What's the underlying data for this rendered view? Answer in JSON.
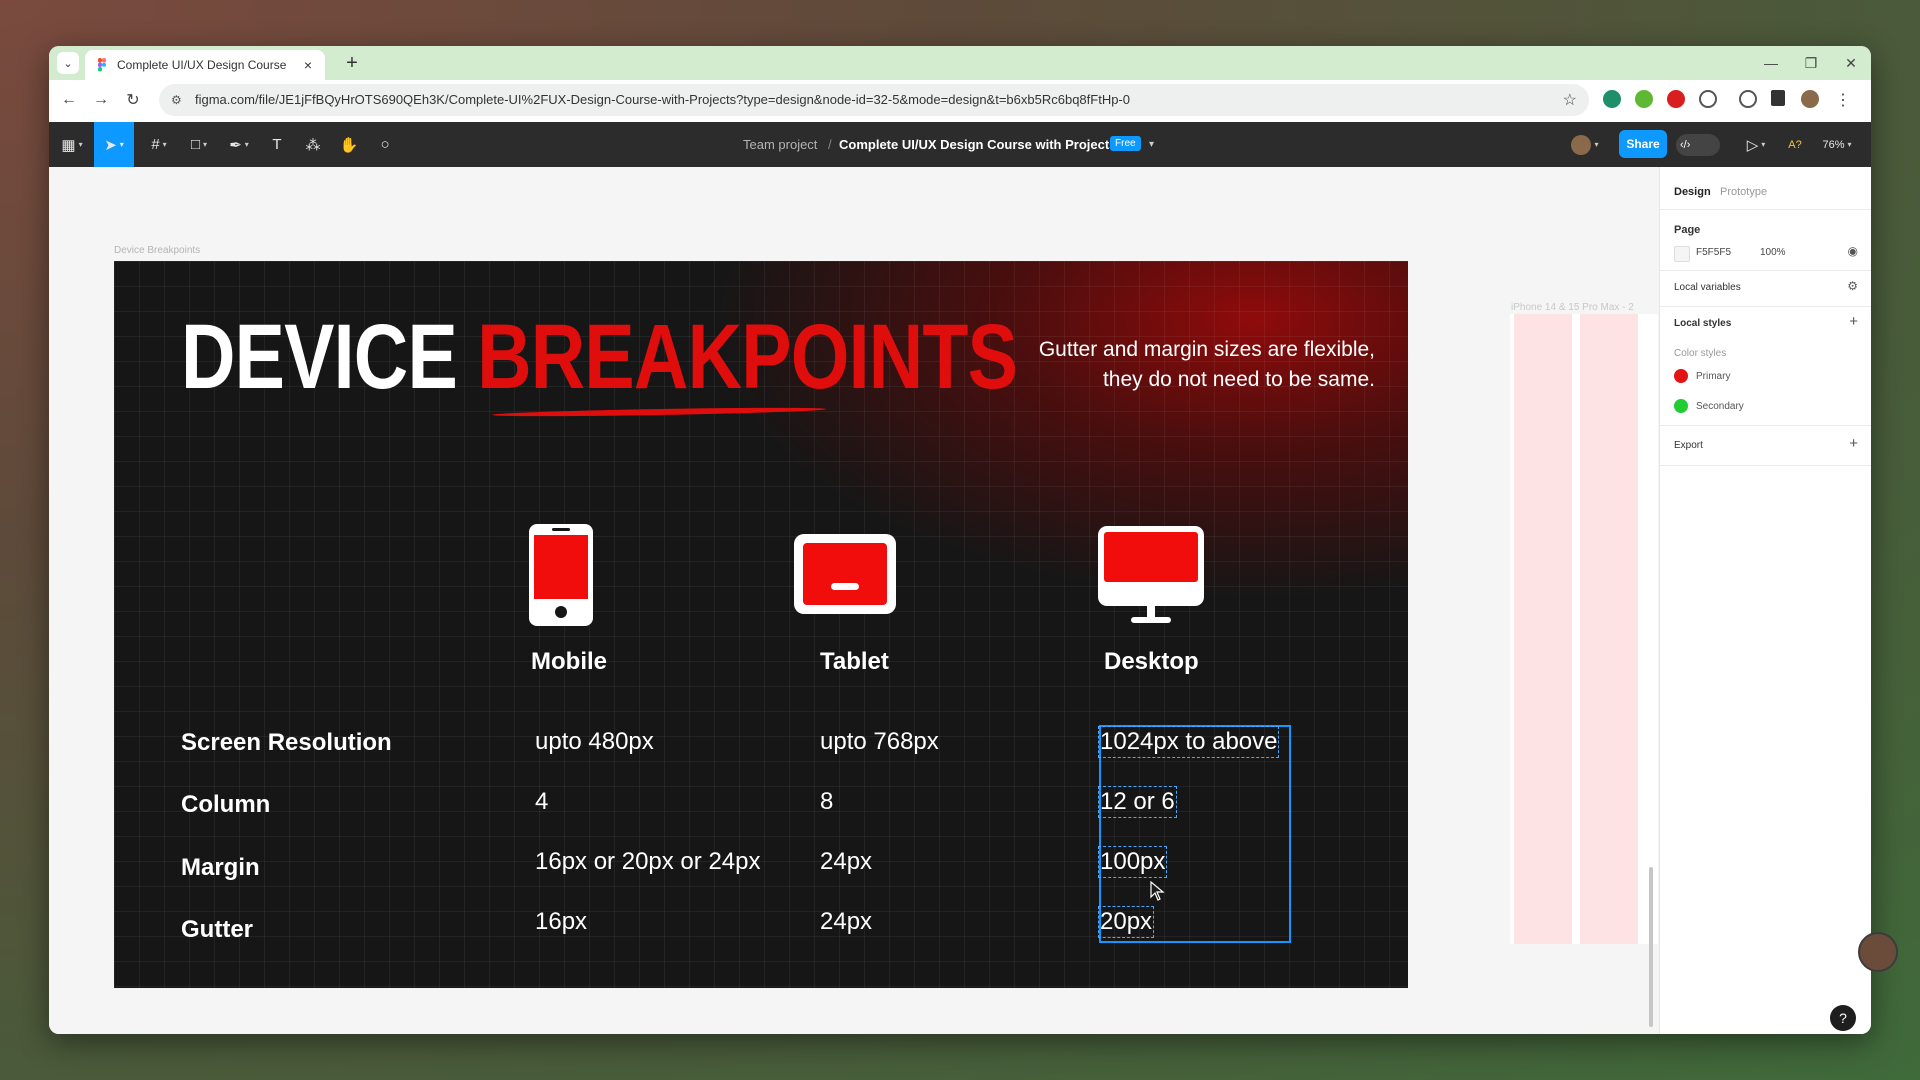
{
  "browser": {
    "tab_title": "Complete UI/UX Design Course",
    "tab_close": "×",
    "new_tab": "+",
    "url": "figma.com/file/JE1jFfBQyHrOTS690QEh3K/Complete-UI%2FUX-Design-Course-with-Projects?type=design&node-id=32-5&mode=design&t=b6xb5Rc6bq8fFtHp-0"
  },
  "figma_toolbar": {
    "breadcrumb_team": "Team project",
    "breadcrumb_sep": "/",
    "file_name": "Complete UI/UX Design Course with Projects",
    "plan_badge": "Free",
    "share_label": "Share",
    "zoom": "76%"
  },
  "canvas": {
    "frame_name": "Device Breakpoints",
    "side_frame_name": "iPhone 14 & 15 Pro Max - 2"
  },
  "slide": {
    "title_white": "DEVICE",
    "title_red": "BREAKPOINTS",
    "note_line1": "Gutter and margin sizes are flexible,",
    "note_line2": "they do not need to be same.",
    "columns": [
      "Mobile",
      "Tablet",
      "Desktop"
    ],
    "rows": [
      {
        "label": "Screen Resolution",
        "mobile": "upto 480px",
        "tablet": "upto 768px",
        "desktop": "1024px to above"
      },
      {
        "label": "Column",
        "mobile": "4",
        "tablet": "8",
        "desktop": "12 or 6"
      },
      {
        "label": "Margin",
        "mobile": "16px or 20px or 24px",
        "tablet": "24px",
        "desktop": "100px"
      },
      {
        "label": "Gutter",
        "mobile": "16px",
        "tablet": "24px",
        "desktop": "20px"
      }
    ],
    "accent_color": "#e00d0d"
  },
  "panel": {
    "tab_design": "Design",
    "tab_prototype": "Prototype",
    "page_label": "Page",
    "page_color": "F5F5F5",
    "page_opacity": "100%",
    "local_variables": "Local variables",
    "local_styles": "Local styles",
    "color_styles": "Color styles",
    "styles": [
      {
        "name": "Primary",
        "color": "#e31414"
      },
      {
        "name": "Secondary",
        "color": "#22cc33"
      }
    ],
    "export": "Export",
    "help": "?"
  }
}
